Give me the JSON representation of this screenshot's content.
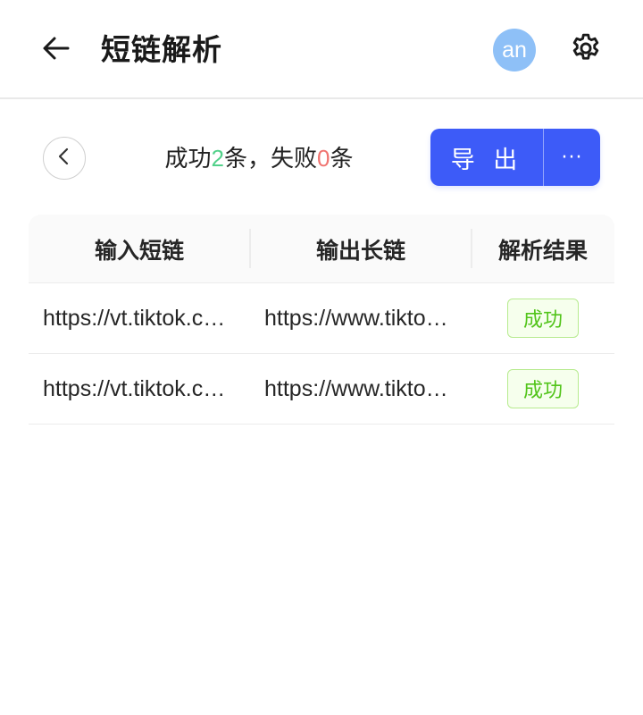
{
  "header": {
    "title": "短链解析",
    "avatar_text": "an",
    "back_icon": "arrow-left-icon",
    "settings_icon": "gear-icon"
  },
  "toolbar": {
    "summary_prefix": "成功",
    "success_count": "2",
    "summary_mid": "条，失败",
    "fail_count": "0",
    "summary_suffix": "条",
    "export_label": "导 出",
    "more_label": "···"
  },
  "table": {
    "headers": [
      "输入短链",
      "输出长链",
      "解析结果"
    ],
    "rows": [
      {
        "input": "https://vt.tiktok.com/",
        "output": "https://www.tiktok.com/",
        "status": "成功"
      },
      {
        "input": "https://vt.tiktok.com/",
        "output": "https://www.tiktok.com/",
        "status": "成功"
      }
    ]
  },
  "colors": {
    "accent": "#3d5bf8",
    "avatar": "#8ec0f7",
    "success_count": "#52d18a",
    "fail_count": "#f07470",
    "tag_success": "#52c41a"
  }
}
